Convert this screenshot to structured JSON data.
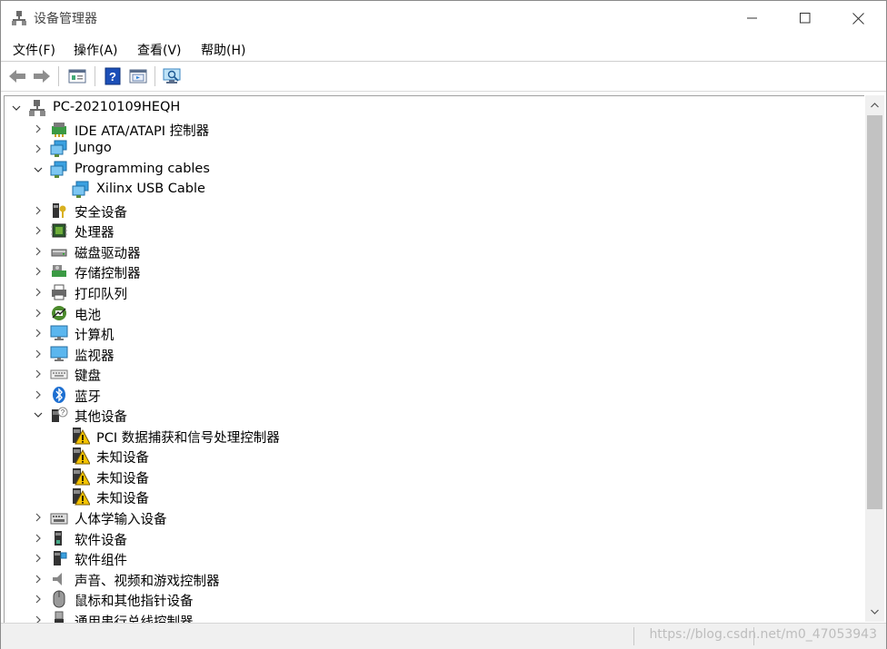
{
  "window": {
    "title": "设备管理器"
  },
  "menubar": {
    "items": [
      "文件(F)",
      "操作(A)",
      "查看(V)",
      "帮助(H)"
    ]
  },
  "toolbar": {
    "buttons": [
      "back-icon",
      "forward-icon",
      "properties-icon",
      "help-icon",
      "view-icon",
      "scan-hardware-icon"
    ]
  },
  "tree": {
    "root": "PC-20210109HEQH",
    "items": [
      {
        "label": "IDE ATA/ATAPI 控制器",
        "icon": "ide-controller-icon",
        "expanded": false
      },
      {
        "label": "Jungo",
        "icon": "network-icon",
        "expanded": false
      },
      {
        "label": "Programming cables",
        "icon": "network-icon",
        "expanded": true
      },
      {
        "label": "Xilinx USB Cable",
        "icon": "network-icon",
        "child": true
      },
      {
        "label": "安全设备",
        "icon": "security-device-icon",
        "expanded": false
      },
      {
        "label": "处理器",
        "icon": "processor-icon",
        "expanded": false
      },
      {
        "label": "磁盘驱动器",
        "icon": "disk-drive-icon",
        "expanded": false
      },
      {
        "label": "存储控制器",
        "icon": "storage-controller-icon",
        "expanded": false
      },
      {
        "label": "打印队列",
        "icon": "printer-icon",
        "expanded": false
      },
      {
        "label": "电池",
        "icon": "battery-icon",
        "expanded": false
      },
      {
        "label": "计算机",
        "icon": "computer-icon",
        "expanded": false
      },
      {
        "label": "监视器",
        "icon": "monitor-icon",
        "expanded": false
      },
      {
        "label": "键盘",
        "icon": "keyboard-icon",
        "expanded": false
      },
      {
        "label": "蓝牙",
        "icon": "bluetooth-icon",
        "expanded": false
      },
      {
        "label": "其他设备",
        "icon": "other-devices-icon",
        "expanded": true
      },
      {
        "label": "PCI 数据捕获和信号处理控制器",
        "icon": "warning-device-icon",
        "child": true
      },
      {
        "label": "未知设备",
        "icon": "warning-device-icon",
        "child": true
      },
      {
        "label": "未知设备",
        "icon": "warning-device-icon",
        "child": true
      },
      {
        "label": "未知设备",
        "icon": "warning-device-icon",
        "child": true
      },
      {
        "label": "人体学输入设备",
        "icon": "hid-icon",
        "expanded": false
      },
      {
        "label": "软件设备",
        "icon": "software-device-icon",
        "expanded": false
      },
      {
        "label": "软件组件",
        "icon": "software-component-icon",
        "expanded": false
      },
      {
        "label": "声音、视频和游戏控制器",
        "icon": "audio-icon",
        "expanded": false
      },
      {
        "label": "鼠标和其他指针设备",
        "icon": "mouse-icon",
        "expanded": false
      },
      {
        "label": "通用串行总线控制器",
        "icon": "usb-icon",
        "expanded": false
      }
    ]
  },
  "statusbar": {
    "watermark": "https://blog.csdn.net/m0_47053943"
  },
  "colors": {
    "accent": "#2a7fd4",
    "warning": "#f5c400",
    "network": "#3aa0e0"
  }
}
